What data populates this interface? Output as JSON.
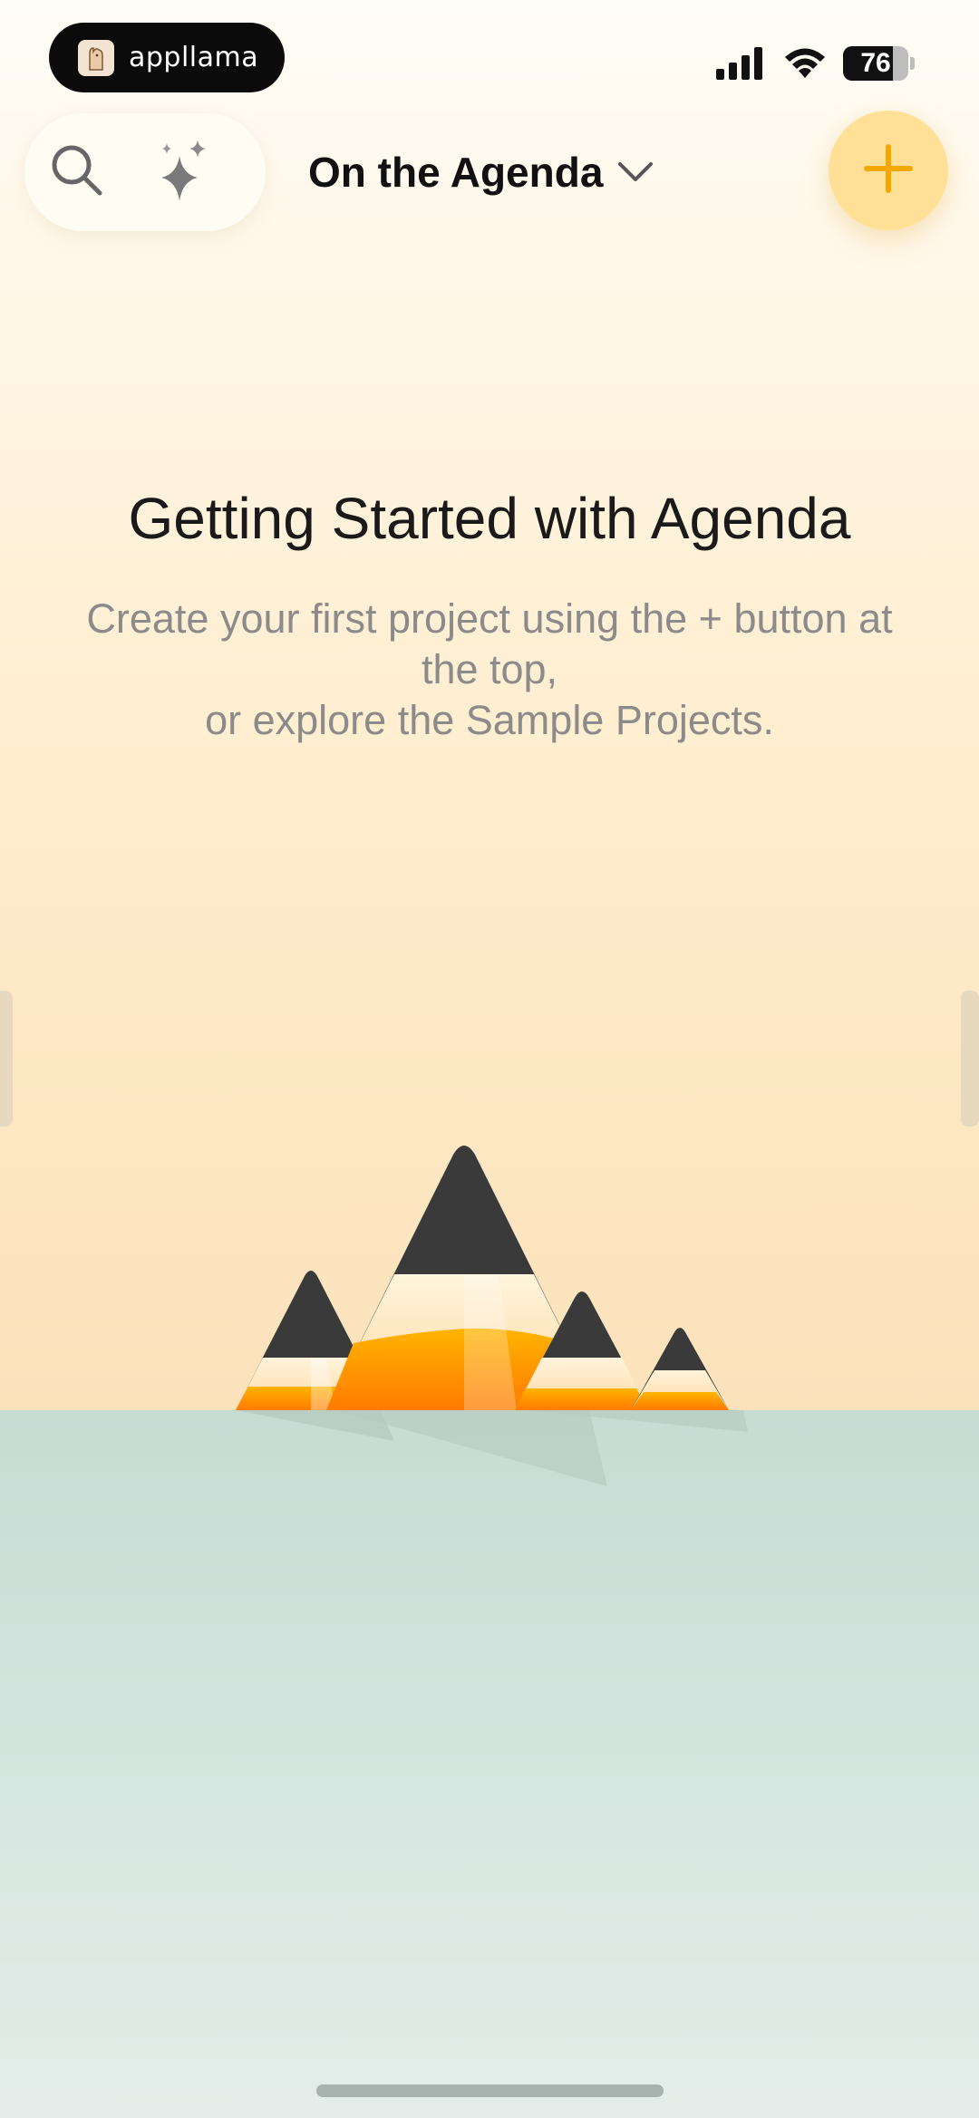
{
  "status_bar": {
    "brand_app": "appllama",
    "battery": "76",
    "battery_level": 0.76
  },
  "toolbar": {
    "search_icon": "search-icon",
    "sparkle_icon": "sparkle-icon",
    "title": "On the Agenda",
    "add_icon": "plus-icon"
  },
  "empty_state": {
    "heading": "Getting Started with Agenda",
    "line1": "Create your first project using the + button at",
    "line2": "the top,",
    "line3": "or explore the Sample Projects."
  },
  "colors": {
    "accent": "#f5a800",
    "add_button_bg": "#ffe096",
    "pencil_dark": "#3a3a3a",
    "pencil_orange": "#ff8a00",
    "water": "#c5dcd3"
  }
}
